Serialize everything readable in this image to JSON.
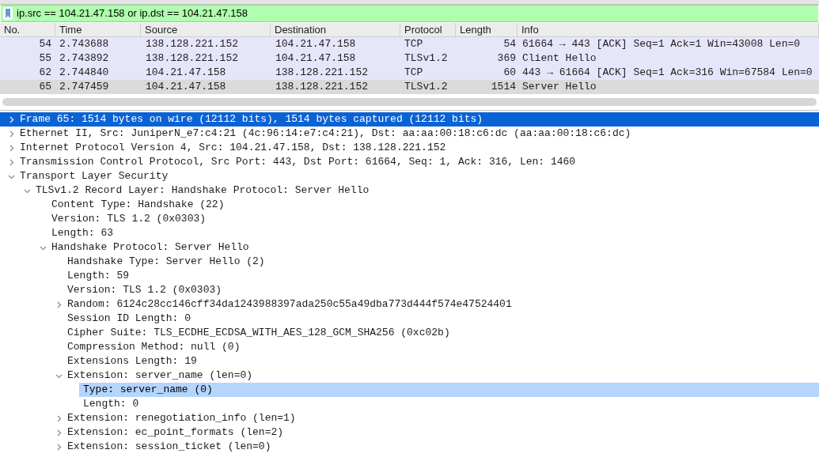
{
  "filter": {
    "value": "ip.src == 104.21.47.158 or ip.dst == 104.21.47.158"
  },
  "packet_list": {
    "columns": [
      "No.",
      "Time",
      "Source",
      "Destination",
      "Protocol",
      "Length",
      "Info"
    ],
    "rows": [
      {
        "selected": false,
        "cells": [
          "54",
          "2.743688",
          "138.128.221.152",
          "104.21.47.158",
          "TCP",
          "54",
          "61664 → 443 [ACK] Seq=1 Ack=1 Win=43008 Len=0"
        ]
      },
      {
        "selected": false,
        "cells": [
          "55",
          "2.743892",
          "138.128.221.152",
          "104.21.47.158",
          "TLSv1.2",
          "369",
          "Client Hello"
        ]
      },
      {
        "selected": false,
        "cells": [
          "62",
          "2.744840",
          "104.21.47.158",
          "138.128.221.152",
          "TCP",
          "60",
          "443 → 61664 [ACK] Seq=1 Ack=316 Win=67584 Len=0"
        ]
      },
      {
        "selected": true,
        "cells": [
          "65",
          "2.747459",
          "104.21.47.158",
          "138.128.221.152",
          "TLSv1.2",
          "1514",
          "Server Hello"
        ]
      }
    ]
  },
  "details": [
    {
      "text": "Frame 65: 1514 bytes on wire (12112 bits), 1514 bytes captured (12112 bits)",
      "selected": true,
      "focused": true,
      "expanded": false
    },
    {
      "text": "Ethernet II, Src: JuniperN_e7:c4:21 (4c:96:14:e7:c4:21), Dst: aa:aa:00:18:c6:dc (aa:aa:00:18:c6:dc)",
      "selected": false,
      "focused": false,
      "expanded": false
    },
    {
      "text": "Internet Protocol Version 4, Src: 104.21.47.158, Dst: 138.128.221.152",
      "selected": false,
      "focused": false,
      "expanded": false
    },
    {
      "text": "Transmission Control Protocol, Src Port: 443, Dst Port: 61664, Seq: 1, Ack: 316, Len: 1460",
      "selected": false,
      "focused": false,
      "expanded": false
    },
    {
      "text": "Transport Layer Security",
      "selected": false,
      "focused": false,
      "expanded": true,
      "children": [
        {
          "text": "TLSv1.2 Record Layer: Handshake Protocol: Server Hello",
          "selected": false,
          "focused": false,
          "expanded": true,
          "children": [
            {
              "text": "Content Type: Handshake (22)",
              "selected": false,
              "focused": false
            },
            {
              "text": "Version: TLS 1.2 (0x0303)",
              "selected": false,
              "focused": false
            },
            {
              "text": "Length: 63",
              "selected": false,
              "focused": false
            },
            {
              "text": "Handshake Protocol: Server Hello",
              "selected": false,
              "focused": false,
              "expanded": true,
              "children": [
                {
                  "text": "Handshake Type: Server Hello (2)",
                  "selected": false,
                  "focused": false
                },
                {
                  "text": "Length: 59",
                  "selected": false,
                  "focused": false
                },
                {
                  "text": "Version: TLS 1.2 (0x0303)",
                  "selected": false,
                  "focused": false
                },
                {
                  "text": "Random: 6124c28cc146cff34da1243988397ada250c55a49dba773d444f574e47524401",
                  "selected": false,
                  "focused": false,
                  "expanded": false
                },
                {
                  "text": "Session ID Length: 0",
                  "selected": false,
                  "focused": false
                },
                {
                  "text": "Cipher Suite: TLS_ECDHE_ECDSA_WITH_AES_128_GCM_SHA256 (0xc02b)",
                  "selected": false,
                  "focused": false
                },
                {
                  "text": "Compression Method: null (0)",
                  "selected": false,
                  "focused": false
                },
                {
                  "text": "Extensions Length: 19",
                  "selected": false,
                  "focused": false
                },
                {
                  "text": "Extension: server_name (len=0)",
                  "selected": false,
                  "focused": false,
                  "expanded": true,
                  "children": [
                    {
                      "text": "Type: server_name (0)",
                      "selected": true,
                      "focused": false
                    },
                    {
                      "text": "Length: 0",
                      "selected": false,
                      "focused": false
                    }
                  ]
                },
                {
                  "text": "Extension: renegotiation_info (len=1)",
                  "selected": false,
                  "focused": false,
                  "expanded": false
                },
                {
                  "text": "Extension: ec_point_formats (len=2)",
                  "selected": false,
                  "focused": false,
                  "expanded": false
                },
                {
                  "text": "Extension: session_ticket (len=0)",
                  "selected": false,
                  "focused": false,
                  "expanded": false
                }
              ]
            }
          ]
        }
      ]
    }
  ]
}
